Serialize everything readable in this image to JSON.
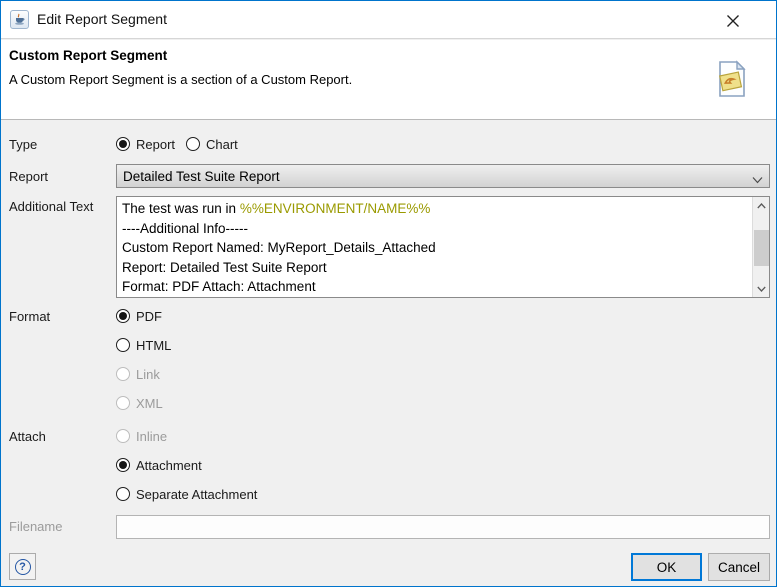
{
  "window": {
    "title": "Edit Report Segment"
  },
  "header": {
    "title": "Custom Report Segment",
    "description": "A Custom Report Segment is a section of a Custom Report."
  },
  "form": {
    "type": {
      "label": "Type",
      "options": [
        {
          "label": "Report",
          "selected": true,
          "enabled": true
        },
        {
          "label": "Chart",
          "selected": false,
          "enabled": true
        }
      ]
    },
    "report": {
      "label": "Report",
      "value": "Detailed Test Suite Report"
    },
    "additional_text": {
      "label": "Additional Text",
      "line1_prefix": "The test was run in ",
      "line1_token": "%%ENVIRONMENT/NAME%%",
      "line2": "----Additional Info-----",
      "line3": "Custom Report Named: MyReport_Details_Attached",
      "line4": "Report: Detailed Test Suite Report",
      "line5": "Format: PDF Attach: Attachment"
    },
    "format": {
      "label": "Format",
      "options": [
        {
          "label": "PDF",
          "selected": true,
          "enabled": true
        },
        {
          "label": "HTML",
          "selected": false,
          "enabled": true
        },
        {
          "label": "Link",
          "selected": false,
          "enabled": false
        },
        {
          "label": "XML",
          "selected": false,
          "enabled": false
        }
      ]
    },
    "attach": {
      "label": "Attach",
      "options": [
        {
          "label": "Inline",
          "selected": false,
          "enabled": false
        },
        {
          "label": "Attachment",
          "selected": true,
          "enabled": true
        },
        {
          "label": "Separate Attachment",
          "selected": false,
          "enabled": true
        }
      ]
    },
    "filename": {
      "label": "Filename",
      "value": "",
      "enabled": false
    }
  },
  "footer": {
    "help_label": "?",
    "ok_label": "OK",
    "cancel_label": "Cancel"
  },
  "colors": {
    "window_border": "#0074cc",
    "accent": "#0078d7",
    "body_background": "#f0f0f0",
    "header_background": "#ffffff",
    "variable_token": "#9a9a00"
  }
}
